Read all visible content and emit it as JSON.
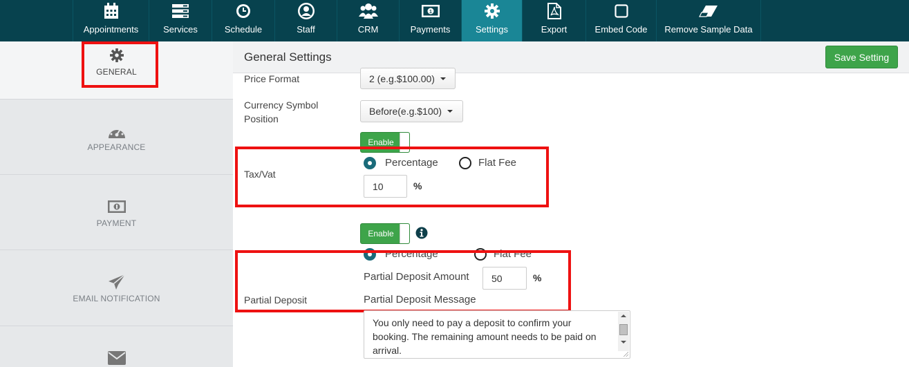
{
  "nav": {
    "items": [
      {
        "label": "Appointments",
        "icon": "calendar-icon"
      },
      {
        "label": "Services",
        "icon": "list-icon"
      },
      {
        "label": "Schedule",
        "icon": "clock-icon"
      },
      {
        "label": "Staff",
        "icon": "user-icon"
      },
      {
        "label": "CRM",
        "icon": "users-icon"
      },
      {
        "label": "Payments",
        "icon": "money-icon"
      },
      {
        "label": "Settings",
        "icon": "gear-icon",
        "active": true
      },
      {
        "label": "Export",
        "icon": "pdf-icon"
      },
      {
        "label": "Embed Code",
        "icon": "square-icon"
      },
      {
        "label": "Remove Sample Data",
        "icon": "eraser-icon"
      }
    ]
  },
  "sidebar": {
    "items": [
      {
        "label": "GENERAL",
        "icon": "gear-icon",
        "active": true
      },
      {
        "label": "APPEARANCE",
        "icon": "dashboard-icon"
      },
      {
        "label": "PAYMENT",
        "icon": "money-icon"
      },
      {
        "label": "EMAIL NOTIFICATION",
        "icon": "paper-plane-icon"
      },
      {
        "label": "",
        "icon": "envelope-icon"
      }
    ]
  },
  "header": {
    "title": "General Settings",
    "save_label": "Save Setting"
  },
  "form": {
    "price_format": {
      "label": "Price Format",
      "value": "2 (e.g.$100.00)"
    },
    "currency_position": {
      "label": "Currency Symbol Position",
      "value": "Before(e.g.$100)"
    },
    "tax": {
      "label": "Tax/Vat",
      "toggle": "Enable",
      "option_percentage": "Percentage",
      "option_flat": "Flat Fee",
      "selected": "Percentage",
      "value": "10",
      "unit": "%"
    },
    "deposit": {
      "label": "Partial Deposit",
      "toggle": "Enable",
      "option_percentage": "Percentage",
      "option_flat": "Flat Fee",
      "selected": "Percentage",
      "amount_label": "Partial Deposit Amount",
      "amount_value": "50",
      "unit": "%",
      "message_label": "Partial Deposit Message",
      "message_value": "You only need to pay a deposit to confirm your booking. The remaining amount needs to be paid on arrival."
    }
  },
  "colors": {
    "nav_bg": "#07424e",
    "nav_active": "#1a8696",
    "enable_green": "#3ea44a",
    "highlight_red": "#ee1111"
  }
}
